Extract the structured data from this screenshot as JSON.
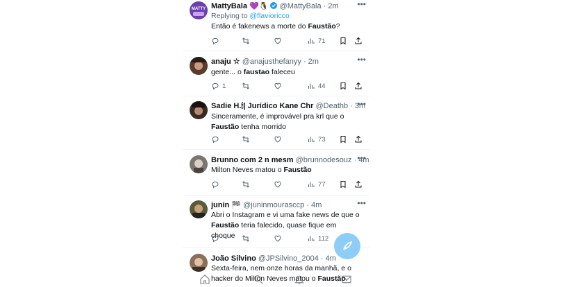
{
  "tweets": [
    {
      "name": "MattyBala 💜🐧",
      "handle": "@MattyBala",
      "time": "· 2m",
      "reply_label": "Replying to ",
      "reply_handle": "@flavioricco",
      "text_a": "Então é fakenews a morte do ",
      "text_b": "Faustão",
      "text_c": "?",
      "replies": "",
      "views": "71"
    },
    {
      "name": "anaju ☆",
      "handle": "@anajusthefanyy",
      "time": "· 2m",
      "text_a": "gente... o ",
      "text_b": "faustao",
      "text_c": " faleceu",
      "replies": "1",
      "views": "44"
    },
    {
      "name": "Sadie H.🕯| Jurídico Kane Chr",
      "handle": "@Deathb",
      "time": "· 3m",
      "text_a": "Sinceramente, é improvável pra krl que o",
      "text_b": "Faustão",
      "text_c": " tenha morrido",
      "replies": "",
      "views": "73"
    },
    {
      "name": "Brunno com 2 n mesm",
      "handle": "@brunnodesouz",
      "time": "· 4m",
      "text_a": "Milton Neves matou o ",
      "text_b": "Faustão",
      "text_c": "",
      "replies": "",
      "views": "77"
    },
    {
      "name": "junin 🏁",
      "handle": "@juninmourasccp",
      "time": "· 4m",
      "text_a": "Abri o Instagram e vi uma fake news de que o",
      "text_b": "Faustão",
      "text_c": " teria falecido, quase fique em choque",
      "replies": "",
      "views": "112"
    },
    {
      "name": "João Silvino",
      "handle": "@JPSilvino_2004",
      "time": "· 4m",
      "text_a": "Sexta-feira, nem onze horas da manhã, e o",
      "text_b2": "hacker do Milton Neves matou o ",
      "text_b": "Faustão",
      "text_c": "."
    }
  ],
  "more_label": "•••",
  "colors": {
    "accent": "#1d9bf0",
    "muted": "#536471",
    "fab": "#8ecdf7"
  },
  "icons": [
    "reply-icon",
    "retweet-icon",
    "like-icon",
    "views-icon",
    "bookmark-icon",
    "share-icon",
    "compose-icon",
    "home-icon",
    "search-icon",
    "notifications-icon",
    "messages-icon"
  ]
}
